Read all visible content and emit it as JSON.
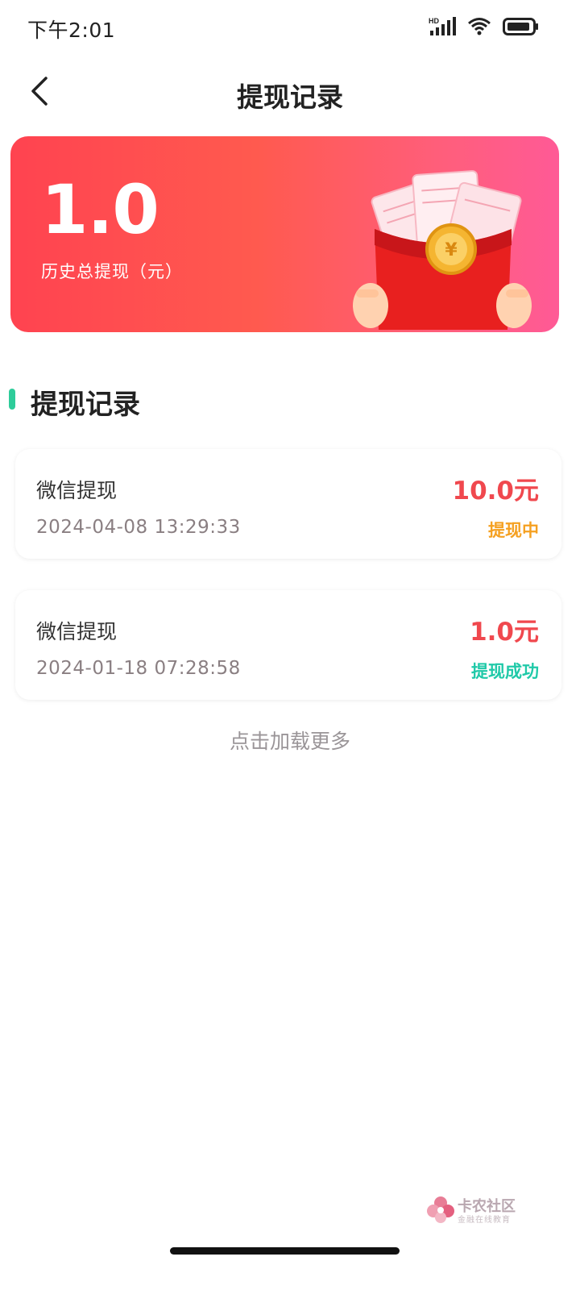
{
  "status_bar": {
    "time": "下午2:01",
    "hd_label": "HD",
    "icons": [
      "signal-icon",
      "wifi-icon",
      "battery-icon"
    ]
  },
  "nav": {
    "title": "提现记录",
    "back_icon": "chevron-left-icon"
  },
  "summary": {
    "amount": "1.0",
    "label": "历史总提现（元）"
  },
  "section": {
    "title": "提现记录",
    "accent_color": "#2ecc9a"
  },
  "records": [
    {
      "type": "微信提现",
      "time": "2024-04-08 13:29:33",
      "amount": "10.0元",
      "status": "提现中",
      "status_color": "#f5a020"
    },
    {
      "type": "微信提现",
      "time": "2024-01-18 07:28:58",
      "amount": "1.0元",
      "status": "提现成功",
      "status_color": "#1fc9a8"
    }
  ],
  "load_more": "点击加载更多",
  "watermark": {
    "text": "卡农社区",
    "sub": "金融在线教育"
  },
  "colors": {
    "amount_red": "#f0484e",
    "card_gradient_start": "#ff4350",
    "card_gradient_end": "#ff5a96"
  }
}
